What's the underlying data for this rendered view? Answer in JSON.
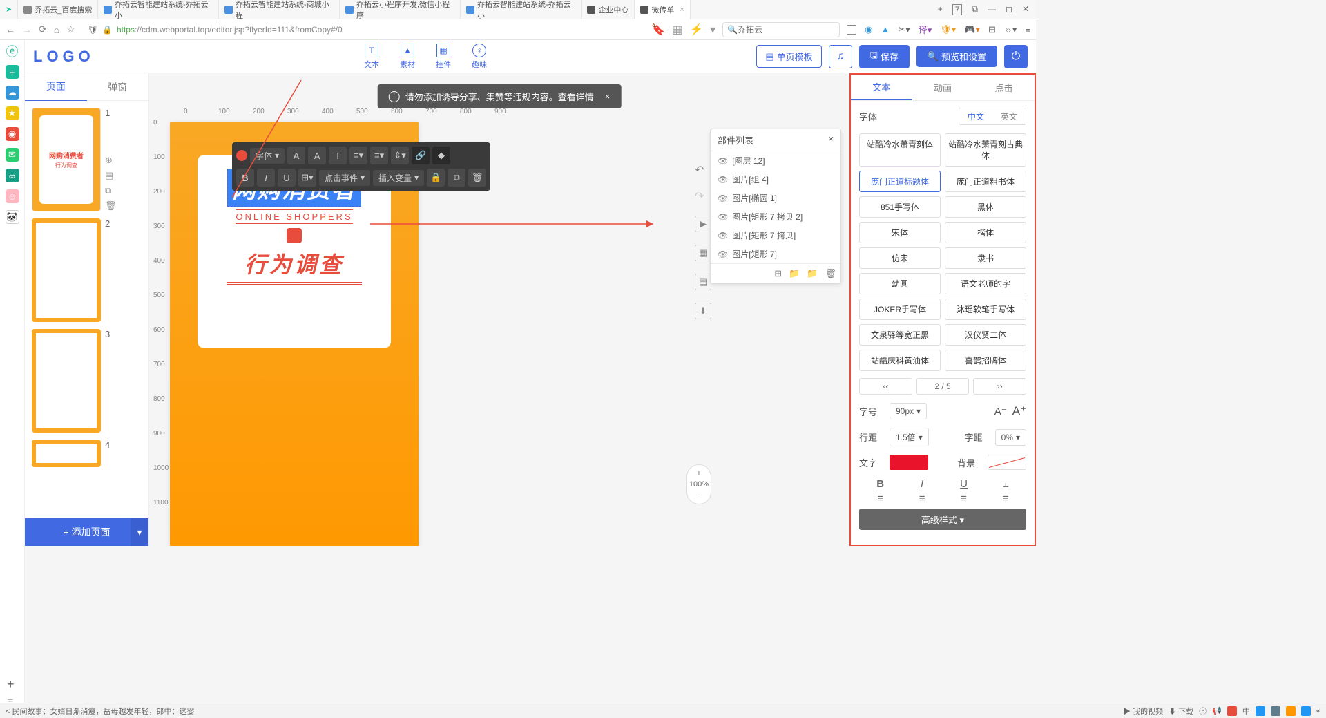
{
  "browser": {
    "tabs": [
      {
        "icon": "paw",
        "label": "乔拓云_百度搜索"
      },
      {
        "icon": "n",
        "label": "乔拓云智能建站系统-乔拓云小"
      },
      {
        "icon": "n",
        "label": "乔拓云智能建站系统-商城小程"
      },
      {
        "icon": "n",
        "label": "乔拓云小程序开发,微信小程序"
      },
      {
        "icon": "n",
        "label": "乔拓云智能建站系统-乔拓云小"
      },
      {
        "icon": "page",
        "label": "企业中心"
      },
      {
        "icon": "page",
        "label": "微传单",
        "active": true
      }
    ],
    "win": {
      "num": "7"
    },
    "url_prefix": "https",
    "url": "://cdm.webportal.top/editor.jsp?flyerId=111&fromCopy#/0",
    "search": "乔拓云"
  },
  "app": {
    "logo": "LOGO",
    "topTools": [
      {
        "ico": "T",
        "label": "文本"
      },
      {
        "ico": "▲",
        "label": "素材"
      },
      {
        "ico": "▦",
        "label": "控件"
      },
      {
        "ico": "♀",
        "label": "趣味"
      }
    ],
    "btns": {
      "template": "单页模板",
      "save": "保存",
      "preview": "预览和设置"
    }
  },
  "left": {
    "tabs": [
      "页面",
      "弹窗"
    ],
    "addPage": "+  添加页面",
    "nums": [
      "1",
      "2",
      "3",
      "4"
    ]
  },
  "warn": "请勿添加诱导分享、集赞等违规内容。查看详情",
  "rulerH": [
    "0",
    "100",
    "200",
    "300",
    "400",
    "500",
    "600",
    "700",
    "800",
    "900"
  ],
  "rulerV": [
    "0",
    "100",
    "200",
    "300",
    "400",
    "500",
    "600",
    "700",
    "800",
    "900",
    "1000",
    "1100"
  ],
  "flyer": {
    "title": "网购消费者",
    "sub": "ONLINE SHOPPERS",
    "big2": "行为调查"
  },
  "toolbar": {
    "font": "字体",
    "click": "点击事件",
    "insert": "插入变量"
  },
  "layers": {
    "title": "部件列表",
    "items": [
      "[图层 12]",
      "图片[组 4]",
      "图片[椭圆 1]",
      "图片[矩形 7 拷贝 2]",
      "图片[矩形 7 拷贝]",
      "图片[矩形 7]"
    ]
  },
  "zoom": "100%",
  "right": {
    "tabs": [
      "文本",
      "动画",
      "点击"
    ],
    "fontLabel": "字体",
    "langs": [
      "中文",
      "英文"
    ],
    "fonts": [
      "站酷冷水萧青刻体",
      "站酷冷水萧青刻古典体",
      "庞门正道标题体",
      "庞门正道粗书体",
      "851手写体",
      "黑体",
      "宋体",
      "楷体",
      "仿宋",
      "隶书",
      "幼圆",
      "语文老师的字",
      "JOKER手写体",
      "沐瑶软笔手写体",
      "文泉驿等宽正黑",
      "汉仪贤二体",
      "站酷庆科黄油体",
      "喜鹊招牌体"
    ],
    "pager": {
      "prev": "‹‹",
      "page": "2 / 5",
      "next": "››"
    },
    "size": {
      "label": "字号",
      "val": "90px"
    },
    "line": {
      "label": "行距",
      "val": "1.5倍"
    },
    "letter": {
      "label": "字距",
      "val": "0%"
    },
    "textcolor": "文字",
    "bgcolor": "背景",
    "adv": "高级样式"
  },
  "bottom": {
    "left": "民间故事：女婿日渐消瘦，岳母越发年轻，郎中：这婴",
    "video": "我的视频",
    "dl": "下载",
    "zh": "中"
  }
}
